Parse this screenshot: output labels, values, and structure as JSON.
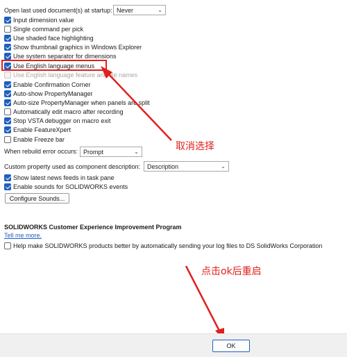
{
  "startup": {
    "label": "Open last used document(s) at startup:",
    "value": "Never"
  },
  "options": [
    {
      "label": "Input dimension value",
      "checked": true
    },
    {
      "label": "Single command per pick",
      "checked": false
    },
    {
      "label": "Use shaded face highlighting",
      "checked": true
    },
    {
      "label": "Show thumbnail graphics in Windows Explorer",
      "checked": true
    },
    {
      "label": "Use system separator for dimensions",
      "checked": true
    },
    {
      "label": "Use English language menus",
      "checked": true
    },
    {
      "label": "Use English language feature and file names",
      "checked": false,
      "disabled": true
    },
    {
      "label": "Enable Confirmation Corner",
      "checked": true
    },
    {
      "label": "Auto-show PropertyManager",
      "checked": true
    },
    {
      "label": "Auto-size PropertyManager when panels are split",
      "checked": true
    },
    {
      "label": "Automatically edit macro after recording",
      "checked": false
    },
    {
      "label": "Stop VSTA debugger on macro exit",
      "checked": true
    },
    {
      "label": "Enable FeatureXpert",
      "checked": true
    },
    {
      "label": "Enable Freeze bar",
      "checked": false
    }
  ],
  "rebuild_error": {
    "label": "When rebuild error occurs:",
    "value": "Prompt"
  },
  "custom_property": {
    "label": "Custom property used as component description:",
    "value": "Description"
  },
  "options2": [
    {
      "label": "Show latest news feeds in task pane",
      "checked": true
    },
    {
      "label": "Enable sounds for SOLIDWORKS events",
      "checked": true
    }
  ],
  "configure_sounds_label": "Configure Sounds...",
  "ceip": {
    "title": "SOLIDWORKS Customer Experience Improvement Program",
    "link": "Tell me more.",
    "option_label": "Help make SOLIDWORKS products better by automatically sending your log files to DS SolidWorks Corporation",
    "option_checked": false
  },
  "annotations": {
    "uncheck": "取消选择",
    "click_ok": "点击ok后重启"
  },
  "ok_label": "OK",
  "colors": {
    "accent": "#1f5fbf",
    "annotation": "#e0201c"
  }
}
